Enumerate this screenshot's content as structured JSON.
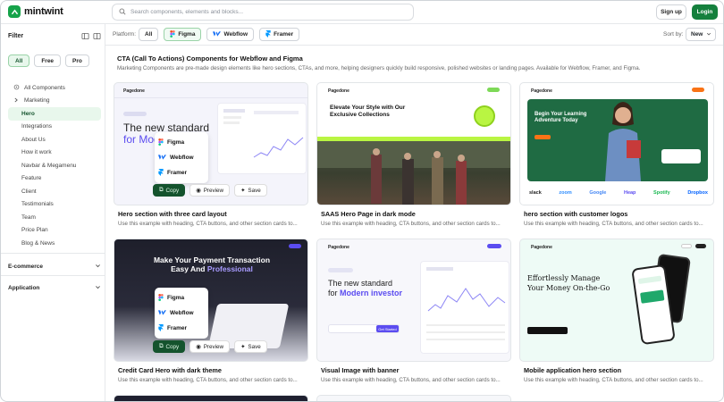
{
  "app": {
    "name": "mintwint"
  },
  "search": {
    "placeholder": "Search components, elements and blocks..."
  },
  "header": {
    "signup": "Sign up",
    "login": "Login"
  },
  "sidebar": {
    "filter": "Filter",
    "pills": [
      "All",
      "Free",
      "Pro"
    ],
    "tree_root": "All Components",
    "marketing": "Marketing",
    "items": [
      "Hero",
      "Integrations",
      "About Us",
      "How it work",
      "Navbar & Megamenu",
      "Feature",
      "Client",
      "Testimonials",
      "Team",
      "Price Plan",
      "Blog & News"
    ],
    "sections": [
      "E-commerce",
      "Application"
    ]
  },
  "platform": {
    "label": "Platform:",
    "options": [
      "All",
      "Figma",
      "Webflow",
      "Framer"
    ],
    "sort_label": "Sort by:",
    "sort_value": "New"
  },
  "page": {
    "title": "CTA (Call To Actions) Components for Webflow and Figma",
    "description": "Marketing Components are pre-made design elements like hero sections, CTAs, and more, helping designers quickly build responsive, polished websites or landing pages. Available for Webflow, Framer, and Figma."
  },
  "cards": [
    {
      "title": "Hero section with three card layout",
      "desc": "Use this example with heading, CTA buttons, and other section cards to..."
    },
    {
      "title": "SAAS Hero Page in dark mode",
      "desc": "Use this example with heading, CTA buttons, and other section cards to..."
    },
    {
      "title": "hero section with customer logos",
      "desc": "Use this example with heading, CTA buttons, and other section cards to..."
    },
    {
      "title": "Credit Card Hero with dark theme",
      "desc": "Use this example with heading, CTA buttons, and other section cards to..."
    },
    {
      "title": "Visual Image with banner",
      "desc": "Use this example with heading, CTA buttons, and other section cards to..."
    },
    {
      "title": "Mobile application hero section",
      "desc": "Use this example with heading, CTA buttons, and other section cards to..."
    }
  ],
  "card_actions": {
    "copy": "Copy",
    "preview": "Preview",
    "save": "Save"
  },
  "thumbs": {
    "pagedone": "Pagedone",
    "t1_headline_a": "The new standard",
    "t1_headline_b": "for Mod",
    "t2_headline": "Elevate Your Style with Our Exclusive Collections",
    "t3_headline": "Begin Your Learning Adventure Today",
    "t3_logos": [
      "slack",
      "zoom",
      "Google",
      "Heap",
      "Spotify",
      "Dropbox"
    ],
    "t4_headline_a": "Make Your Payment Transaction",
    "t4_headline_b": "Easy And",
    "t4_headline_c": "Professional",
    "t5_headline_a": "The new standard",
    "t5_headline_b": "for",
    "t5_headline_c": "Modern investor",
    "t5_cta": "Get Started",
    "t6_headline_a": "Effortlessly Manage",
    "t6_headline_b": "Your Money On-the-Go"
  },
  "colors": {
    "brand": "#15803d",
    "accent_light": "#e8f7ec",
    "purple": "#5b4cf0",
    "lime": "#b9f542"
  }
}
